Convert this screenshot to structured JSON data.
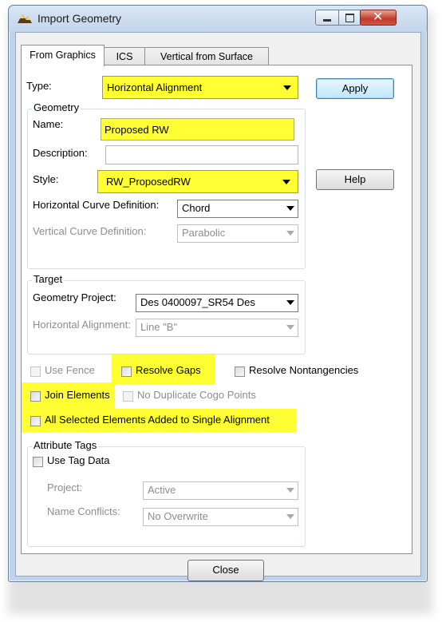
{
  "window": {
    "title": "Import Geometry"
  },
  "tabs": [
    "From Graphics",
    "ICS",
    "Vertical from Surface"
  ],
  "form": {
    "type_label": "Type:",
    "type_value": "Horizontal Alignment",
    "apply_label": "Apply",
    "help_label": "Help",
    "geometry": {
      "title": "Geometry",
      "name_label": "Name:",
      "name_value": "Proposed RW",
      "description_label": "Description:",
      "description_value": "",
      "style_label": "Style:",
      "style_value": "RW_ProposedRW",
      "hcurve_label": "Horizontal Curve Definition:",
      "hcurve_value": "Chord",
      "vcurve_label": "Vertical Curve Definition:",
      "vcurve_value": "Parabolic"
    },
    "target": {
      "title": "Target",
      "project_label": "Geometry Project:",
      "project_value": "Des 0400097_SR54 Des",
      "halign_label": "Horizontal Alignment:",
      "halign_value": "Line \"B\""
    },
    "options": {
      "use_fence": "Use Fence",
      "resolve_gaps": "Resolve Gaps",
      "resolve_nontangencies": "Resolve Nontangencies",
      "join_elements": "Join Elements",
      "no_duplicate": "No Duplicate Cogo Points",
      "all_selected": "All Selected Elements Added to Single Alignment"
    },
    "attribute_tags": {
      "title": "Attribute Tags",
      "use_tag_data": "Use Tag Data",
      "project_label": "Project:",
      "project_value": "Active",
      "conflicts_label": "Name Conflicts:",
      "conflicts_value": "No Overwrite"
    },
    "close_label": "Close"
  },
  "colors": {
    "highlight": "#ffff33",
    "disabled_text": "#8d8d8d"
  }
}
